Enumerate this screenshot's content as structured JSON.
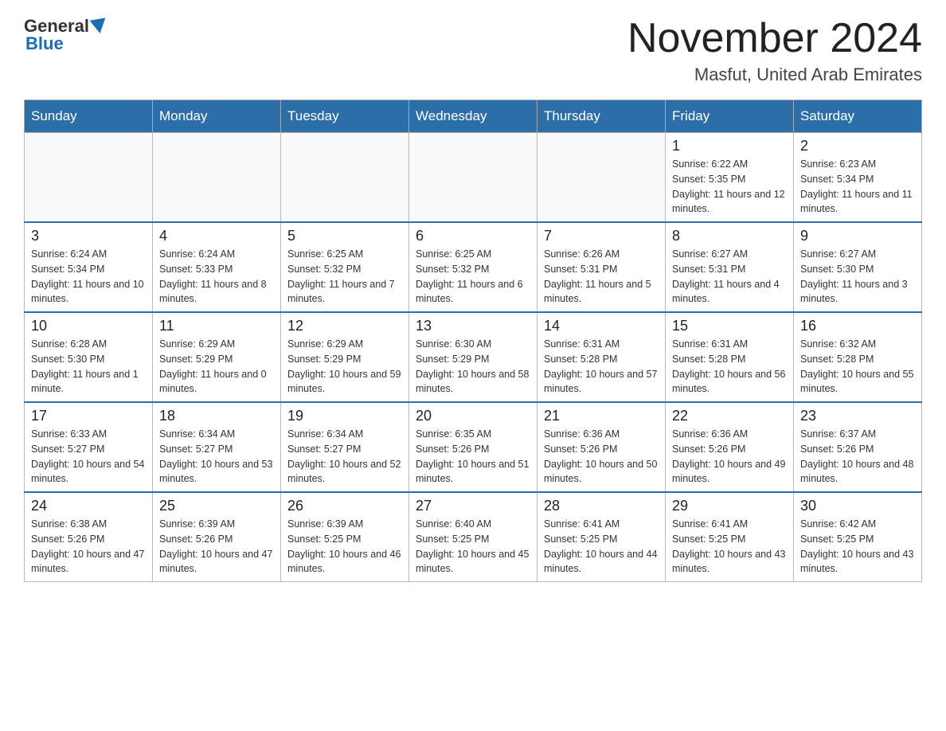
{
  "header": {
    "logo_general": "General",
    "logo_blue": "Blue",
    "month_year": "November 2024",
    "location": "Masfut, United Arab Emirates"
  },
  "weekdays": [
    "Sunday",
    "Monday",
    "Tuesday",
    "Wednesday",
    "Thursday",
    "Friday",
    "Saturday"
  ],
  "rows": [
    [
      {
        "day": "",
        "info": ""
      },
      {
        "day": "",
        "info": ""
      },
      {
        "day": "",
        "info": ""
      },
      {
        "day": "",
        "info": ""
      },
      {
        "day": "",
        "info": ""
      },
      {
        "day": "1",
        "info": "Sunrise: 6:22 AM\nSunset: 5:35 PM\nDaylight: 11 hours and 12 minutes."
      },
      {
        "day": "2",
        "info": "Sunrise: 6:23 AM\nSunset: 5:34 PM\nDaylight: 11 hours and 11 minutes."
      }
    ],
    [
      {
        "day": "3",
        "info": "Sunrise: 6:24 AM\nSunset: 5:34 PM\nDaylight: 11 hours and 10 minutes."
      },
      {
        "day": "4",
        "info": "Sunrise: 6:24 AM\nSunset: 5:33 PM\nDaylight: 11 hours and 8 minutes."
      },
      {
        "day": "5",
        "info": "Sunrise: 6:25 AM\nSunset: 5:32 PM\nDaylight: 11 hours and 7 minutes."
      },
      {
        "day": "6",
        "info": "Sunrise: 6:25 AM\nSunset: 5:32 PM\nDaylight: 11 hours and 6 minutes."
      },
      {
        "day": "7",
        "info": "Sunrise: 6:26 AM\nSunset: 5:31 PM\nDaylight: 11 hours and 5 minutes."
      },
      {
        "day": "8",
        "info": "Sunrise: 6:27 AM\nSunset: 5:31 PM\nDaylight: 11 hours and 4 minutes."
      },
      {
        "day": "9",
        "info": "Sunrise: 6:27 AM\nSunset: 5:30 PM\nDaylight: 11 hours and 3 minutes."
      }
    ],
    [
      {
        "day": "10",
        "info": "Sunrise: 6:28 AM\nSunset: 5:30 PM\nDaylight: 11 hours and 1 minute."
      },
      {
        "day": "11",
        "info": "Sunrise: 6:29 AM\nSunset: 5:29 PM\nDaylight: 11 hours and 0 minutes."
      },
      {
        "day": "12",
        "info": "Sunrise: 6:29 AM\nSunset: 5:29 PM\nDaylight: 10 hours and 59 minutes."
      },
      {
        "day": "13",
        "info": "Sunrise: 6:30 AM\nSunset: 5:29 PM\nDaylight: 10 hours and 58 minutes."
      },
      {
        "day": "14",
        "info": "Sunrise: 6:31 AM\nSunset: 5:28 PM\nDaylight: 10 hours and 57 minutes."
      },
      {
        "day": "15",
        "info": "Sunrise: 6:31 AM\nSunset: 5:28 PM\nDaylight: 10 hours and 56 minutes."
      },
      {
        "day": "16",
        "info": "Sunrise: 6:32 AM\nSunset: 5:28 PM\nDaylight: 10 hours and 55 minutes."
      }
    ],
    [
      {
        "day": "17",
        "info": "Sunrise: 6:33 AM\nSunset: 5:27 PM\nDaylight: 10 hours and 54 minutes."
      },
      {
        "day": "18",
        "info": "Sunrise: 6:34 AM\nSunset: 5:27 PM\nDaylight: 10 hours and 53 minutes."
      },
      {
        "day": "19",
        "info": "Sunrise: 6:34 AM\nSunset: 5:27 PM\nDaylight: 10 hours and 52 minutes."
      },
      {
        "day": "20",
        "info": "Sunrise: 6:35 AM\nSunset: 5:26 PM\nDaylight: 10 hours and 51 minutes."
      },
      {
        "day": "21",
        "info": "Sunrise: 6:36 AM\nSunset: 5:26 PM\nDaylight: 10 hours and 50 minutes."
      },
      {
        "day": "22",
        "info": "Sunrise: 6:36 AM\nSunset: 5:26 PM\nDaylight: 10 hours and 49 minutes."
      },
      {
        "day": "23",
        "info": "Sunrise: 6:37 AM\nSunset: 5:26 PM\nDaylight: 10 hours and 48 minutes."
      }
    ],
    [
      {
        "day": "24",
        "info": "Sunrise: 6:38 AM\nSunset: 5:26 PM\nDaylight: 10 hours and 47 minutes."
      },
      {
        "day": "25",
        "info": "Sunrise: 6:39 AM\nSunset: 5:26 PM\nDaylight: 10 hours and 47 minutes."
      },
      {
        "day": "26",
        "info": "Sunrise: 6:39 AM\nSunset: 5:25 PM\nDaylight: 10 hours and 46 minutes."
      },
      {
        "day": "27",
        "info": "Sunrise: 6:40 AM\nSunset: 5:25 PM\nDaylight: 10 hours and 45 minutes."
      },
      {
        "day": "28",
        "info": "Sunrise: 6:41 AM\nSunset: 5:25 PM\nDaylight: 10 hours and 44 minutes."
      },
      {
        "day": "29",
        "info": "Sunrise: 6:41 AM\nSunset: 5:25 PM\nDaylight: 10 hours and 43 minutes."
      },
      {
        "day": "30",
        "info": "Sunrise: 6:42 AM\nSunset: 5:25 PM\nDaylight: 10 hours and 43 minutes."
      }
    ]
  ]
}
